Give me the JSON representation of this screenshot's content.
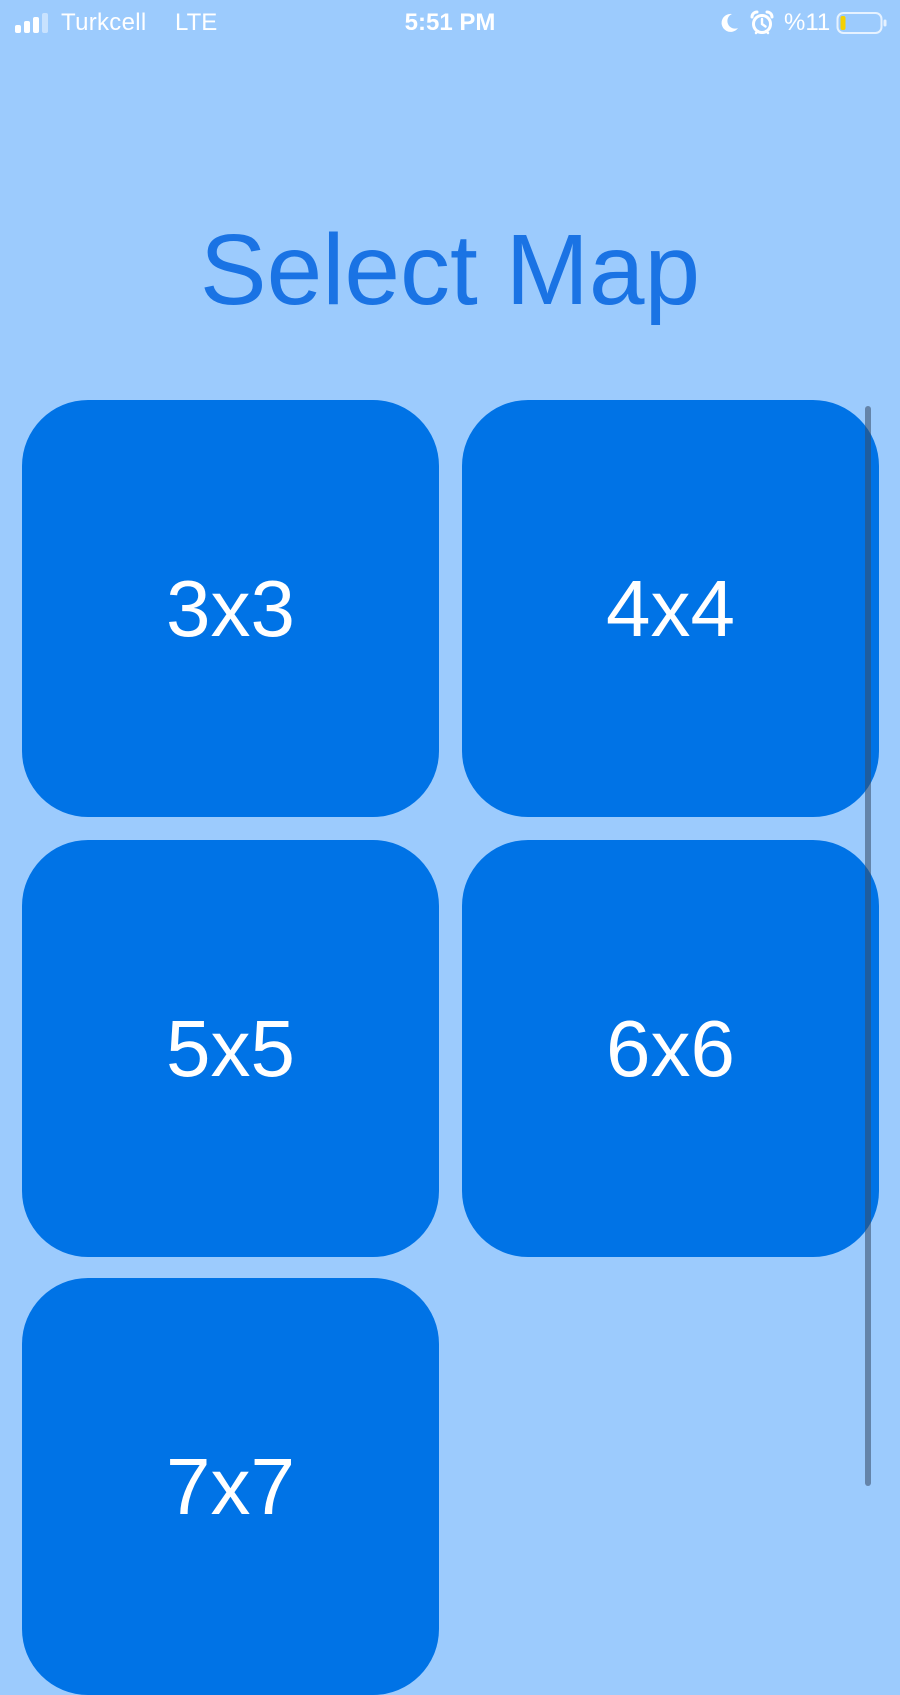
{
  "status_bar": {
    "carrier": "Turkcell",
    "network": "LTE",
    "time": "5:51 PM",
    "battery_text": "%11",
    "battery_level": 0.11,
    "icons": [
      "signal-icon",
      "moon-icon",
      "alarm-icon",
      "battery-icon"
    ]
  },
  "page": {
    "title": "Select Map"
  },
  "maps": [
    {
      "label": "3x3"
    },
    {
      "label": "4x4"
    },
    {
      "label": "5x5"
    },
    {
      "label": "6x6"
    },
    {
      "label": "7x7"
    }
  ],
  "colors": {
    "background": "#9ccbfd",
    "tile": "#0073e6",
    "title": "#1a73e4",
    "battery_fill": "#f5d000"
  }
}
